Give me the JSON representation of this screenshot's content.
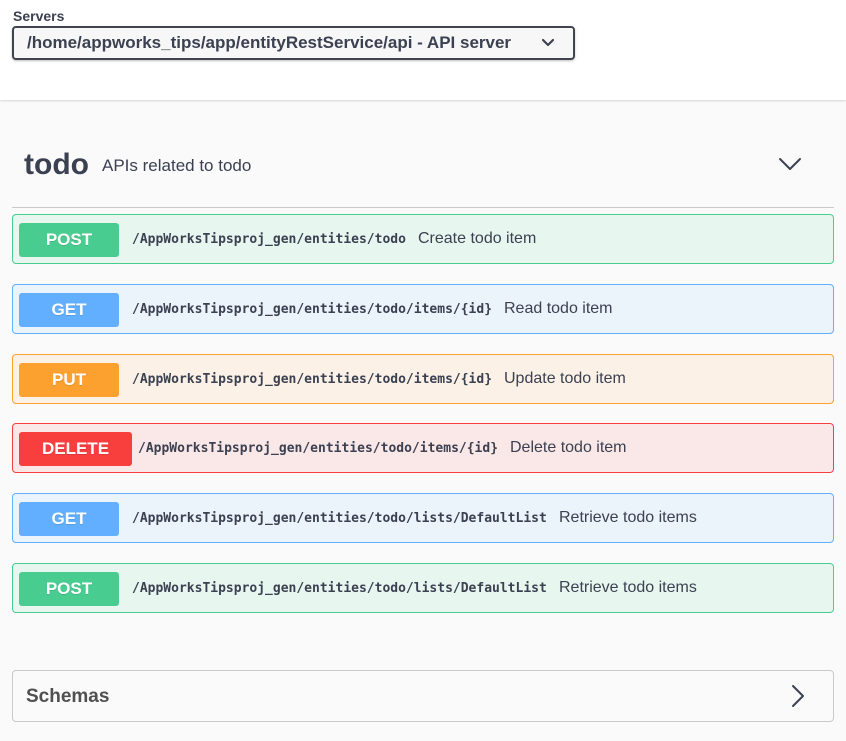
{
  "servers": {
    "label": "Servers",
    "selected": "/home/appworks_tips/app/entityRestService/api - API server"
  },
  "tag": {
    "name": "todo",
    "description": "APIs related to todo"
  },
  "operations": [
    {
      "method": "POST",
      "path": "/AppWorksTipsproj_gen/entities/todo",
      "summary": "Create todo item"
    },
    {
      "method": "GET",
      "path": "/AppWorksTipsproj_gen/entities/todo/items/{id}",
      "summary": "Read todo item"
    },
    {
      "method": "PUT",
      "path": "/AppWorksTipsproj_gen/entities/todo/items/{id}",
      "summary": "Update todo item"
    },
    {
      "method": "DELETE",
      "path": "/AppWorksTipsproj_gen/entities/todo/items/{id}",
      "summary": "Delete todo item"
    },
    {
      "method": "GET",
      "path": "/AppWorksTipsproj_gen/entities/todo/lists/DefaultList",
      "summary": "Retrieve todo items"
    },
    {
      "method": "POST",
      "path": "/AppWorksTipsproj_gen/entities/todo/lists/DefaultList",
      "summary": "Retrieve todo items"
    }
  ],
  "method_colors": {
    "POST": {
      "badge": "#49cc90",
      "border": "#49cc90",
      "bg": "#e8f6f0"
    },
    "GET": {
      "badge": "#61affe",
      "border": "#61affe",
      "bg": "#ebf3fb"
    },
    "PUT": {
      "badge": "#fca130",
      "border": "#fca130",
      "bg": "#fbf1e6"
    },
    "DELETE": {
      "badge": "#f93e3e",
      "border": "#f93e3e",
      "bg": "#fae7e7"
    }
  },
  "schemas": {
    "title": "Schemas"
  },
  "icons": {
    "server_dropdown": "chevron-down-icon",
    "tag_toggle": "chevron-down-icon",
    "schemas_toggle": "chevron-right-icon"
  }
}
